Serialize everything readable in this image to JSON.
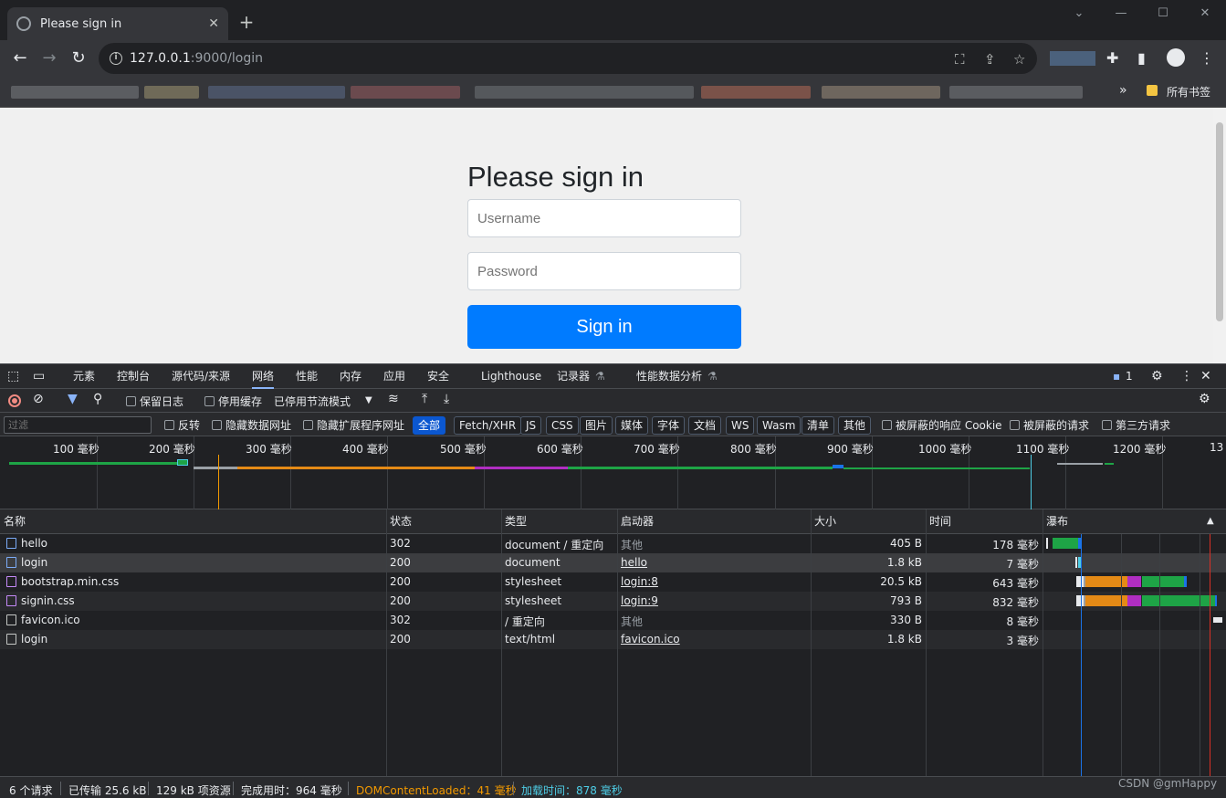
{
  "browser": {
    "tab_title": "Please sign in",
    "url_host": "127.0.0.1",
    "url_path": ":9000/login",
    "bookmark_folder": "所有书签"
  },
  "page": {
    "heading": "Please sign in",
    "username_placeholder": "Username",
    "password_placeholder": "Password",
    "signin_label": "Sign in",
    "primary_color": "#007bff"
  },
  "devtools": {
    "tabs": [
      "元素",
      "控制台",
      "源代码/来源",
      "网络",
      "性能",
      "内存",
      "应用",
      "安全",
      "Lighthouse",
      "记录器",
      "性能数据分析"
    ],
    "active_tab": "网络",
    "issues_count": "1",
    "toolbar": {
      "preserve_log": "保留日志",
      "disable_cache": "停用缓存",
      "throttle": "已停用节流模式"
    },
    "filter": {
      "placeholder": "过滤",
      "invert": "反转",
      "hide_data_urls": "隐藏数据网址",
      "hide_ext_urls": "隐藏扩展程序网址",
      "types": [
        "全部",
        "Fetch/XHR",
        "JS",
        "CSS",
        "图片",
        "媒体",
        "字体",
        "文档",
        "WS",
        "Wasm",
        "清单",
        "其他"
      ],
      "blocked_cookies": "被屏蔽的响应 Cookie",
      "blocked_requests": "被屏蔽的请求",
      "third_party": "第三方请求"
    },
    "overview_ticks": [
      "100 毫秒",
      "200 毫秒",
      "300 毫秒",
      "400 毫秒",
      "500 毫秒",
      "600 毫秒",
      "700 毫秒",
      "800 毫秒",
      "900 毫秒",
      "1000 毫秒",
      "1100 毫秒",
      "1200 毫秒",
      "13"
    ],
    "columns": [
      "名称",
      "状态",
      "类型",
      "启动器",
      "大小",
      "时间",
      "瀑布"
    ],
    "rows": [
      {
        "name": "hello",
        "status": "302",
        "type": "document / 重定向",
        "initiator": "其他",
        "size": "405 B",
        "time": "178 毫秒"
      },
      {
        "name": "login",
        "status": "200",
        "type": "document",
        "initiator": "hello",
        "size": "1.8 kB",
        "time": "7 毫秒"
      },
      {
        "name": "bootstrap.min.css",
        "status": "200",
        "type": "stylesheet",
        "initiator": "login:8",
        "size": "20.5 kB",
        "time": "643 毫秒"
      },
      {
        "name": "signin.css",
        "status": "200",
        "type": "stylesheet",
        "initiator": "login:9",
        "size": "793 B",
        "time": "832 毫秒"
      },
      {
        "name": "favicon.ico",
        "status": "302",
        "type": "/ 重定向",
        "initiator": "其他",
        "size": "330 B",
        "time": "8 毫秒"
      },
      {
        "name": "login",
        "status": "200",
        "type": "text/html",
        "initiator": "favicon.ico",
        "size": "1.8 kB",
        "time": "3 毫秒"
      }
    ],
    "status": {
      "requests": "6 个请求",
      "transferred": "已传输 25.6 kB",
      "resources": "129 kB 项资源",
      "finish": "完成用时：964 毫秒",
      "dcl": "DOMContentLoaded：41 毫秒",
      "load": "加载时间：878 毫秒"
    }
  },
  "watermark": "CSDN @gmHappy"
}
